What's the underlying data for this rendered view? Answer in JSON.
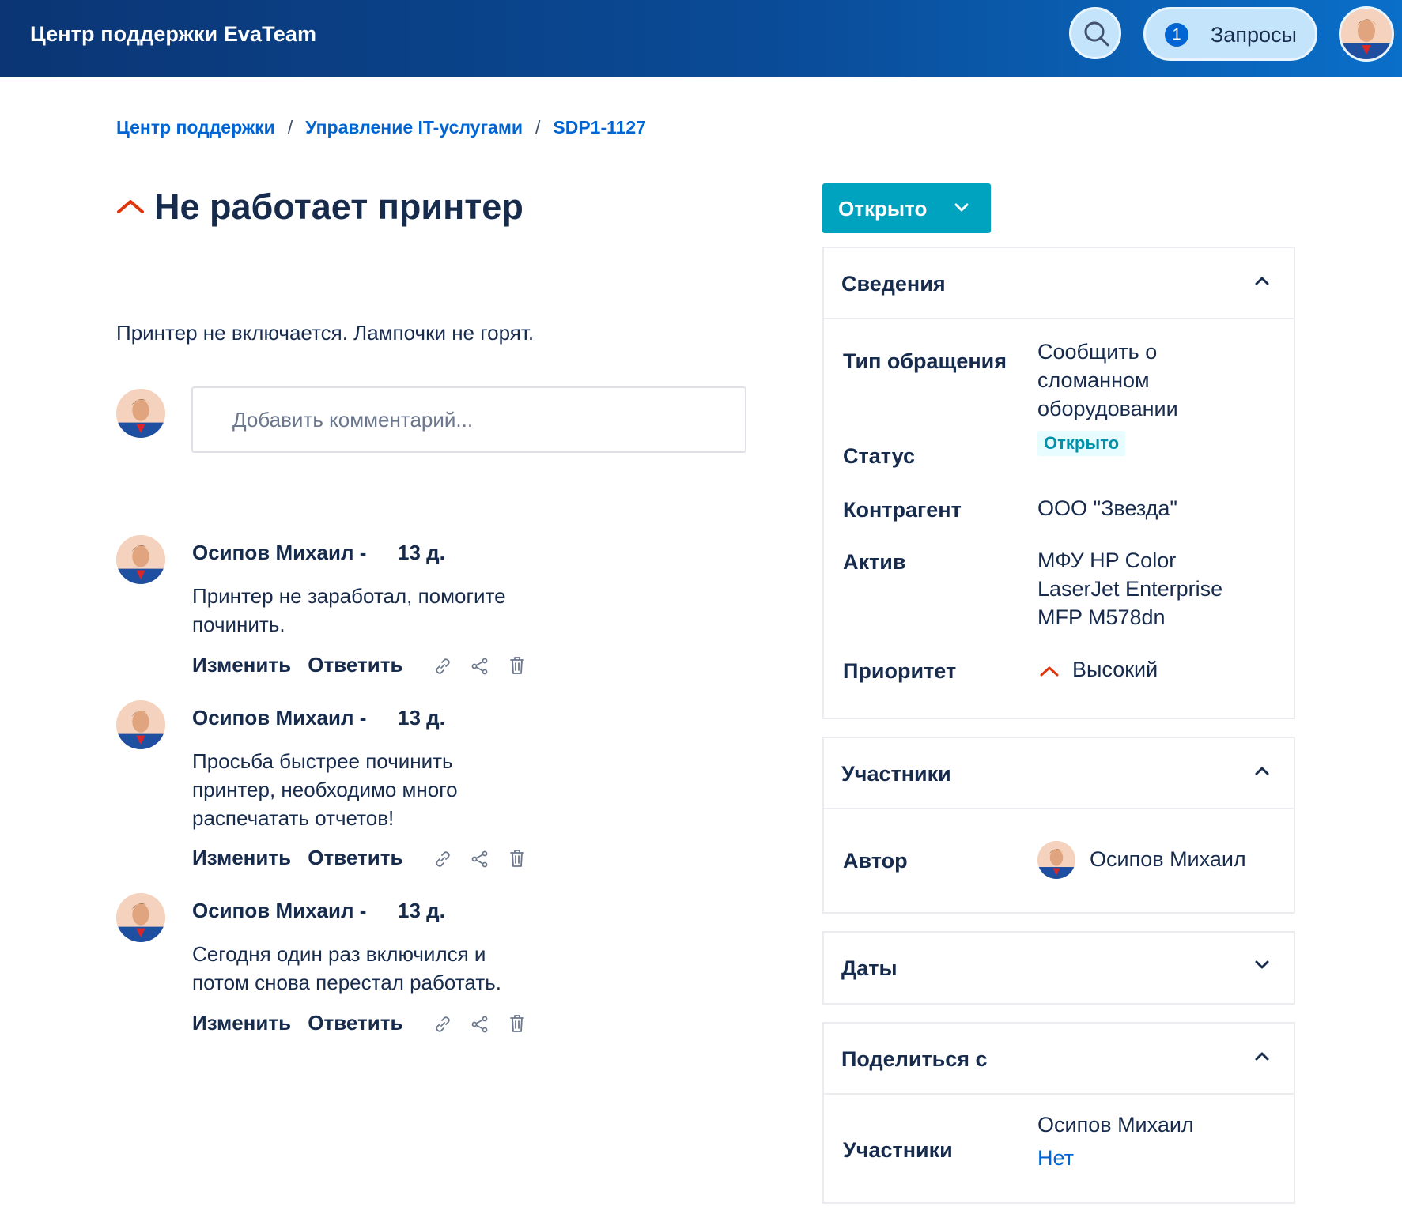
{
  "header": {
    "brand": "Центр поддержки EvaTeam",
    "requests_count": "1",
    "requests_label": "Запросы",
    "accent": "#0b3574"
  },
  "breadcrumb": {
    "items": [
      "Центр поддержки",
      "Управление IT-услугами",
      "SDP1-1127"
    ],
    "separator": "/"
  },
  "issue": {
    "priority_icon": "priority-high-icon",
    "title": "Не работает принтер",
    "description": "Принтер не включается. Лампочки не горят."
  },
  "comment_box": {
    "placeholder": "Добавить комментарий..."
  },
  "comments": [
    {
      "author": "Осипов Михаил -",
      "time": "13 д.",
      "body": "Принтер не заработал, помогите починить.",
      "edit_label": "Изменить",
      "reply_label": "Ответить"
    },
    {
      "author": "Осипов Михаил -",
      "time": "13 д.",
      "body": "Просьба быстрее починить принтер, необходимо много распечатать отчетов!",
      "edit_label": "Изменить",
      "reply_label": "Ответить"
    },
    {
      "author": "Осипов Михаил -",
      "time": "13 д.",
      "body": "Сегодня один раз включился и потом снова перестал работать.",
      "edit_label": "Изменить",
      "reply_label": "Ответить"
    }
  ],
  "status_button": {
    "label": "Открыто",
    "color": "#00a3bf"
  },
  "details": {
    "title": "Сведения",
    "type_label": "Тип обращения",
    "type_value": "Сообщить о сломанном оборудовании",
    "status_label": "Статус",
    "status_value": "Открыто",
    "counterparty_label": "Контрагент",
    "counterparty_value": "ООО \"Звезда\"",
    "asset_label": "Актив",
    "asset_value": "МФУ HP Color LaserJet Enterprise MFP M578dn",
    "priority_label": "Приоритет",
    "priority_value": "Высокий",
    "priority_color": "#de350b"
  },
  "participants": {
    "title": "Участники",
    "author_label": "Автор",
    "author_name": "Осипов Михаил"
  },
  "dates": {
    "title": "Даты"
  },
  "share": {
    "title": "Поделиться с",
    "participants_label": "Участники",
    "participant_name": "Осипов Михаил",
    "none_label": "Нет"
  }
}
